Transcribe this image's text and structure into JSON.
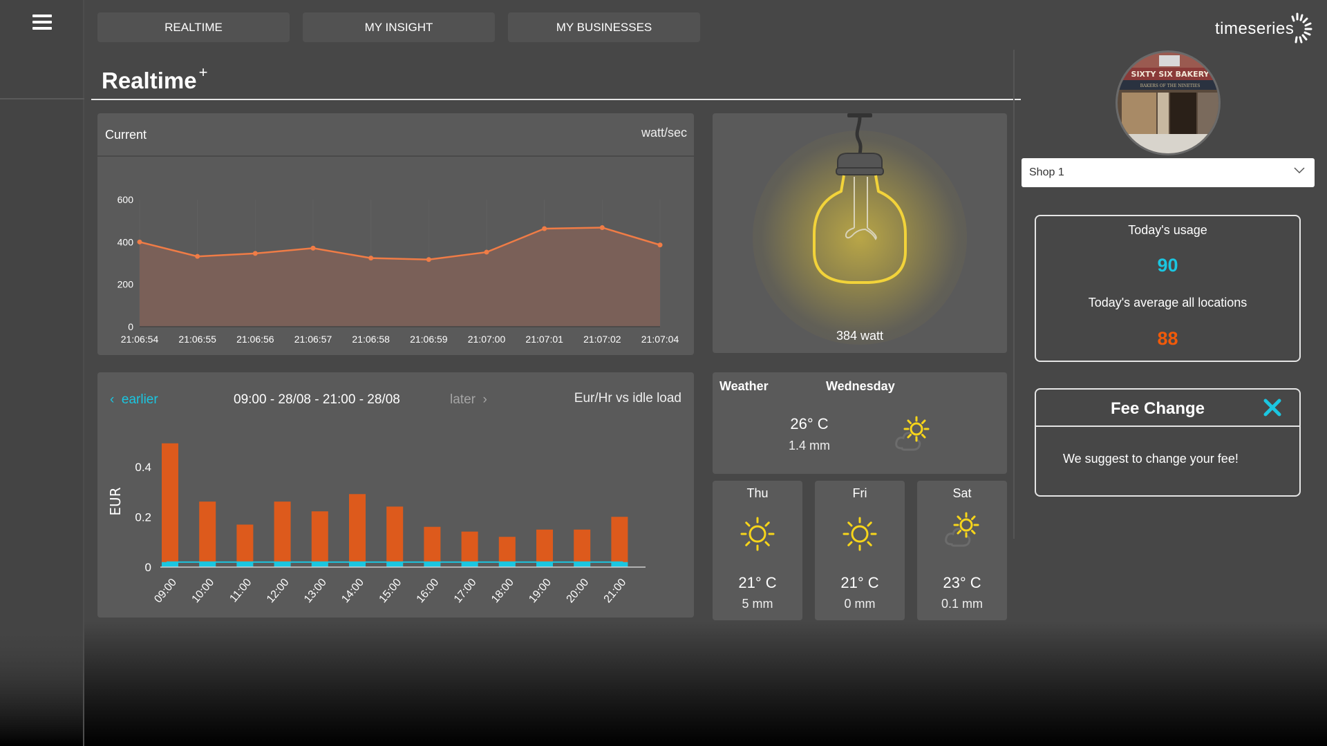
{
  "app": {
    "logo_text": "timeseries"
  },
  "nav": {
    "menu_icon": "hamburger-menu-icon",
    "tabs": [
      {
        "label": "REALTIME",
        "active": true
      },
      {
        "label": "MY INSIGHT",
        "active": false
      },
      {
        "label": "MY BUSINESSES",
        "active": false
      }
    ]
  },
  "page": {
    "title": "Realtime",
    "title_suffix": "+"
  },
  "current_panel": {
    "title": "Current",
    "unit": "watt/sec"
  },
  "bulb_panel": {
    "reading": "384 watt"
  },
  "eur_panel": {
    "earlier_label": "earlier",
    "range_label": "09:00 - 28/08 - 21:00 - 28/08",
    "later_label": "later",
    "unit_label": "Eur/Hr vs idle load"
  },
  "weather": {
    "label": "Weather",
    "today": {
      "day": "Wednesday",
      "temp": "26° C",
      "rain": "1.4 mm",
      "icon": "partly-cloudy-icon"
    },
    "forecast": [
      {
        "day": "Thu",
        "temp": "21° C",
        "rain": "5 mm",
        "icon": "sun-icon"
      },
      {
        "day": "Fri",
        "temp": "21° C",
        "rain": "0 mm",
        "icon": "sun-icon"
      },
      {
        "day": "Sat",
        "temp": "23° C",
        "rain": "0.1 mm",
        "icon": "partly-cloudy-icon"
      }
    ]
  },
  "shop": {
    "avatar_caption": "SIXTY SIX BAKERY",
    "avatar_subcaption": "BAKERS OF THE NINETIES",
    "selected": "Shop 1"
  },
  "usage": {
    "today_label": "Today's usage",
    "today_value": "90",
    "avg_label": "Today's average all locations",
    "avg_value": "88",
    "today_color": "#1bc6e0",
    "avg_color": "#f05a0a"
  },
  "fee_change": {
    "title": "Fee Change",
    "message": "We suggest to change your fee!",
    "close_color": "#1bc6e0"
  },
  "colors": {
    "accent": "#1bc6e0",
    "orange": "#f05a0a",
    "line": "#f07c46",
    "area": "#7a6058",
    "bar": "#dd5a1c",
    "idle": "#1bc6e0"
  },
  "chart_data": [
    {
      "type": "area",
      "title": "Current",
      "ylabel": "watt/sec",
      "x": [
        "21:06:54",
        "21:06:55",
        "21:06:56",
        "21:06:57",
        "21:06:58",
        "21:06:59",
        "21:07:00",
        "21:07:01",
        "21:07:02",
        "21:07:04"
      ],
      "series": [
        {
          "name": "Current",
          "values": [
            400,
            332,
            346,
            371,
            324,
            317,
            352,
            463,
            468,
            386
          ]
        }
      ],
      "yticks": [
        0,
        200,
        400,
        600
      ],
      "ylim": [
        0,
        600
      ],
      "grid": false
    },
    {
      "type": "bar",
      "title": "Eur/Hr vs idle load",
      "ylabel": "EUR",
      "categories": [
        "09:00",
        "10:00",
        "11:00",
        "12:00",
        "13:00",
        "14:00",
        "15:00",
        "16:00",
        "17:00",
        "18:00",
        "19:00",
        "20:00",
        "21:00"
      ],
      "series": [
        {
          "name": "Eur/Hr",
          "values": [
            0.495,
            0.262,
            0.17,
            0.262,
            0.223,
            0.292,
            0.242,
            0.161,
            0.142,
            0.121,
            0.15,
            0.15,
            0.201
          ]
        },
        {
          "name": "Idle load",
          "values": [
            0.02,
            0.02,
            0.02,
            0.02,
            0.02,
            0.02,
            0.02,
            0.02,
            0.02,
            0.02,
            0.02,
            0.02,
            0.02
          ]
        }
      ],
      "yticks": [
        0,
        0.2,
        0.4
      ],
      "ylim": [
        0,
        0.5
      ],
      "grid": false
    }
  ]
}
